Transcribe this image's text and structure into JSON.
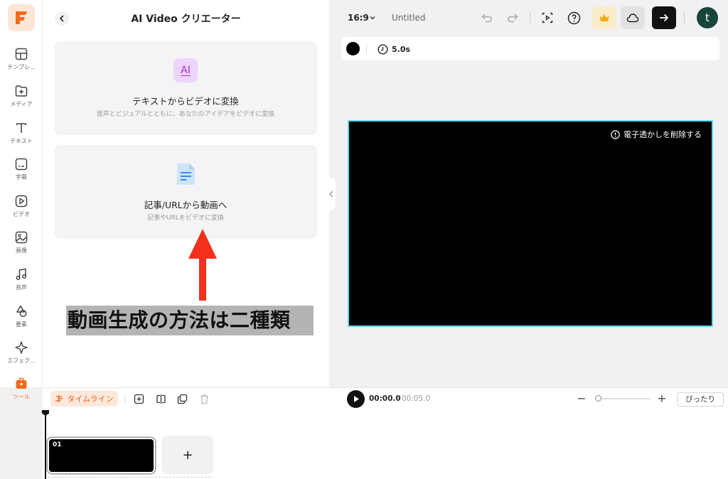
{
  "rail": {
    "items": [
      {
        "label": "テンプレ..."
      },
      {
        "label": "メディア"
      },
      {
        "label": "テキスト"
      },
      {
        "label": "字幕"
      },
      {
        "label": "ビデオ"
      },
      {
        "label": "画像"
      },
      {
        "label": "音声"
      },
      {
        "label": "要素"
      },
      {
        "label": "エフェク..."
      },
      {
        "label": "ツール"
      }
    ]
  },
  "panel": {
    "title": "AI Video クリエーター",
    "cards": [
      {
        "icon_text": "AI",
        "title": "テキストからビデオに変換",
        "subtitle": "音声とビジュアルとともに、あなたのアイデアをビデオに変換"
      },
      {
        "title": "記事/URLから動画へ",
        "subtitle": "記事やURLをビデオに変換"
      }
    ],
    "annotation": "動画生成の方法は二種類"
  },
  "topbar": {
    "aspect_ratio": "16:9",
    "doc_title": "Untitled",
    "avatar_initial": "t"
  },
  "scene": {
    "duration": "5.0s",
    "watermark_label": "電子透かしを削除する"
  },
  "timeline": {
    "label": "タイムライン",
    "current_time": "00:00.0",
    "total_time": "/ 00:05.0",
    "fit_label": "ぴったり",
    "clip_number": "01",
    "add_label": "+"
  },
  "colors": {
    "accent": "#f26b1d",
    "canvas_border": "#5cd8ea",
    "annotation_arrow": "#f2301c"
  }
}
